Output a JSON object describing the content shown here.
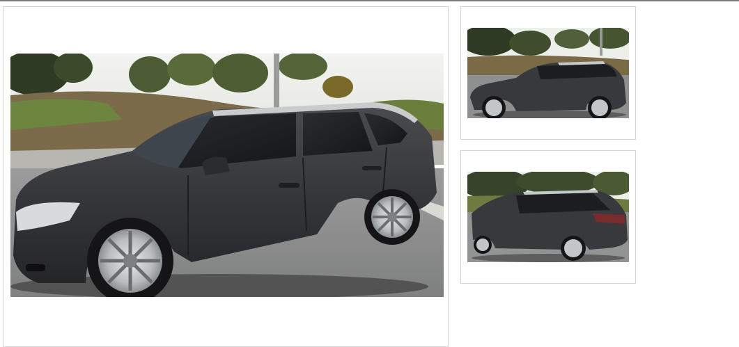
{
  "gallery": {
    "main_image": {
      "icon": "car-photo-side-front-view",
      "selected": true
    },
    "thumbnails": [
      {
        "icon": "car-photo-side-view",
        "index": 1
      },
      {
        "icon": "car-photo-rear-side-view",
        "index": 2
      }
    ]
  },
  "colors": {
    "car_body": "#3a3b3f",
    "sky": "#eef0ee",
    "grass": "#6f7a3e",
    "road": "#8e8f8f",
    "frame_border": "#d4d4d4"
  }
}
